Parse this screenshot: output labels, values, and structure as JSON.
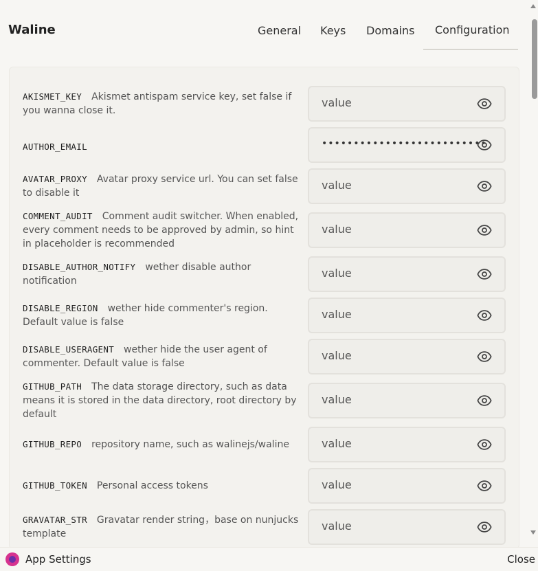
{
  "app": {
    "title": "Waline"
  },
  "tabs": [
    {
      "label": "General"
    },
    {
      "label": "Keys"
    },
    {
      "label": "Domains"
    },
    {
      "label": "Configuration",
      "active": true
    }
  ],
  "settings": [
    {
      "key": "AKISMET_KEY",
      "desc": "Akismet antispam service key, set false if you wanna close it.",
      "value": "value"
    },
    {
      "key": "AUTHOR_EMAIL",
      "desc": "",
      "value": "••••••••••••••••••••••••••"
    },
    {
      "key": "AVATAR_PROXY",
      "desc": "Avatar proxy service url. You can set false to disable it",
      "value": "value"
    },
    {
      "key": "COMMENT_AUDIT",
      "desc": "Comment audit switcher. When enabled, every comment needs to be approved by admin, so hint in placeholder is recommended",
      "value": "value"
    },
    {
      "key": "DISABLE_AUTHOR_NOTIFY",
      "desc": "wether disable author notification",
      "value": "value"
    },
    {
      "key": "DISABLE_REGION",
      "desc": "wether hide commenter's region. Default value is false",
      "value": "value"
    },
    {
      "key": "DISABLE_USERAGENT",
      "desc": "wether hide the user agent of commenter. Default value is false",
      "value": "value"
    },
    {
      "key": "GITHUB_PATH",
      "desc": "The data storage directory, such as data means it is stored in the data directory, root directory by default",
      "value": "value"
    },
    {
      "key": "GITHUB_REPO",
      "desc": "repository name, such as walinejs/waline",
      "value": "value"
    },
    {
      "key": "GITHUB_TOKEN",
      "desc": "Personal access tokens",
      "value": "value"
    },
    {
      "key": "GRAVATAR_STR",
      "desc": "Gravatar render string，base on nunjucks template",
      "value": "value"
    }
  ],
  "icons": {
    "reveal": "eye-icon",
    "app": "app-settings-icon"
  },
  "footer": {
    "label": "App Settings",
    "close": "Close"
  }
}
